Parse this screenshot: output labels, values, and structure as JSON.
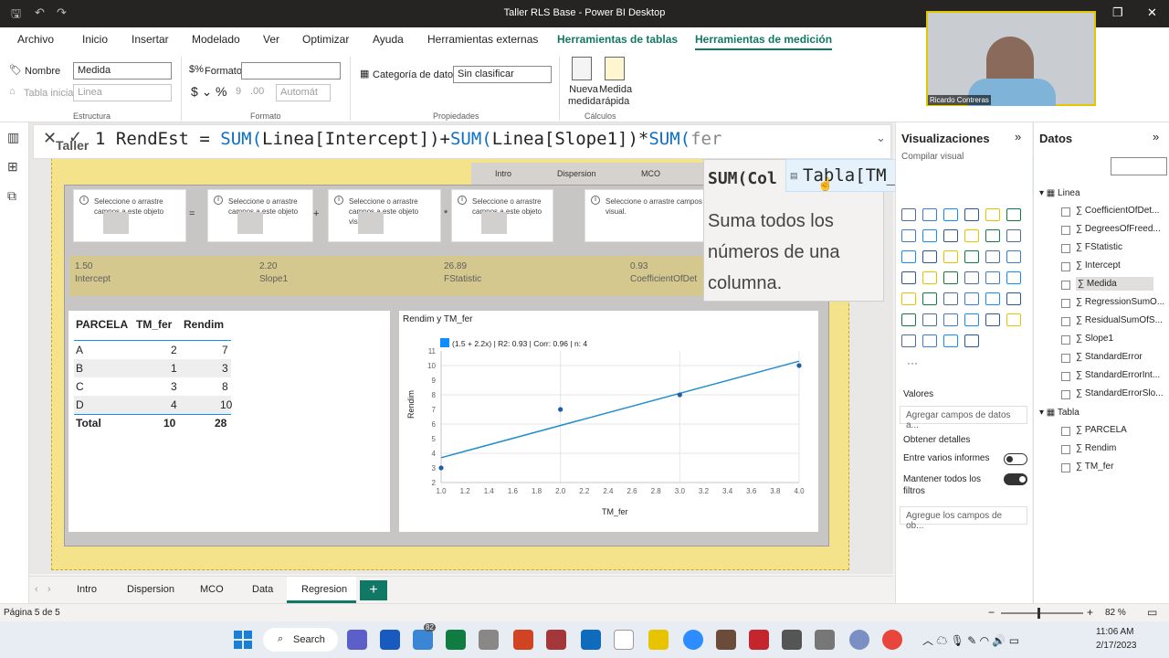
{
  "window": {
    "title": "Taller RLS Base - Power BI Desktop"
  },
  "menu": {
    "items": [
      "Archivo",
      "Inicio",
      "Insertar",
      "Modelado",
      "Ver",
      "Optimizar",
      "Ayuda",
      "Herramientas externas",
      "Herramientas de tablas",
      "Herramientas de medición"
    ]
  },
  "ribbon": {
    "nombre_label": "Nombre",
    "nombre_value": "Medida",
    "tabla_label": "Tabla inicial",
    "tabla_value": "Linea",
    "estructura": "Estructura",
    "formato_label": "Formato",
    "formato_value": "",
    "automatico": "Automát",
    "formato_group": "Formato",
    "categoria_label": "Categoría de datos",
    "categoria_value": "Sin clasificar",
    "propiedades": "Propiedades",
    "nueva_medida": "Nueva medida",
    "medida_rapida": "Medida rápida",
    "calculos": "Cálculos"
  },
  "formula": {
    "prefix": "1 RendEst = ",
    "sum1": "SUM(",
    "arg1": "Linea[Intercept]",
    ")+": ")+",
    "sum2": "SUM(",
    "arg2": "Linea[Slope1]",
    "mid": ")*",
    "sum3": "SUM(",
    "typed": "fer",
    "partial_title": "Taller"
  },
  "form_tabs": [
    "Intro",
    "Dispersion",
    "MCO"
  ],
  "autocomplete": {
    "suggestion": "Tabla[TM_fer]",
    "sig": "SUM(Col",
    "desc": "Suma todos los números de una columna."
  },
  "cards": {
    "msg": "Seleccione o arrastre campos a este objeto visual.",
    "msg_short": "Seleccione o arrastre campos a este objeto",
    "msg_last": "Seleccione o arrastre campos visual."
  },
  "metrics": [
    {
      "value": "1.50",
      "label": "Intercept"
    },
    {
      "value": "2.20",
      "label": "Slope1"
    },
    {
      "value": "26.89",
      "label": "FStatistic"
    },
    {
      "value": "0.93",
      "label": "CoefficientOfDet"
    }
  ],
  "table": {
    "headers": [
      "PARCELA",
      "TM_fer",
      "Rendim"
    ],
    "rows": [
      [
        "A",
        "2",
        "7"
      ],
      [
        "B",
        "1",
        "3"
      ],
      [
        "C",
        "3",
        "8"
      ],
      [
        "D",
        "4",
        "10"
      ]
    ],
    "total": [
      "Total",
      "10",
      "28"
    ]
  },
  "chart_data": {
    "type": "scatter",
    "title": "Rendim y TM_fer",
    "legend": "(1.5 + 2.2x) | R2: 0.93 | Corr: 0.96 | n: 4",
    "xlabel": "TM_fer",
    "ylabel": "Rendim",
    "xlim": [
      1.0,
      4.0
    ],
    "ylim": [
      2,
      11
    ],
    "xticks": [
      "1.0",
      "1.2",
      "1.4",
      "1.6",
      "1.8",
      "2.0",
      "2.2",
      "2.4",
      "2.6",
      "2.8",
      "3.0",
      "3.2",
      "3.4",
      "3.6",
      "3.8",
      "4.0"
    ],
    "yticks": [
      "2",
      "3",
      "4",
      "5",
      "6",
      "7",
      "8",
      "9",
      "10",
      "11"
    ],
    "points": [
      {
        "x": 1,
        "y": 3
      },
      {
        "x": 2,
        "y": 7
      },
      {
        "x": 3,
        "y": 8
      },
      {
        "x": 4,
        "y": 10
      }
    ],
    "line": {
      "intercept": 1.5,
      "slope": 2.2
    },
    "color": "#118dff"
  },
  "viz_pane": {
    "title": "Visualizaciones",
    "compilar": "Compilar visual",
    "valores": "Valores",
    "agregar": "Agregar campos de datos a...",
    "obtener": "Obtener detalles",
    "entre": "Entre varios informes",
    "mantener": "Mantener todos los filtros",
    "agregue": "Agregue los campos de ob..."
  },
  "data_pane": {
    "title": "Datos",
    "linea": "Linea",
    "linea_fields": [
      "CoefficientOfDet...",
      "DegreesOfFreed...",
      "FStatistic",
      "Intercept",
      "Medida",
      "RegressionSumO...",
      "ResidualSumOfS...",
      "Slope1",
      "StandardError",
      "StandardErrorInt...",
      "StandardErrorSlo..."
    ],
    "tabla": "Tabla",
    "tabla_fields": [
      "PARCELA",
      "Rendim",
      "TM_fer"
    ]
  },
  "page_tabs": [
    "Intro",
    "Dispersion",
    "MCO",
    "Data",
    "Regresion"
  ],
  "status": {
    "page": "Página 5 de 5",
    "zoom": "82 %"
  },
  "taskbar": {
    "search": "Search",
    "time": "11:06 AM",
    "date": "2/17/2023",
    "badge": "82"
  },
  "webcam": {
    "name": "Ricardo Contreras"
  }
}
